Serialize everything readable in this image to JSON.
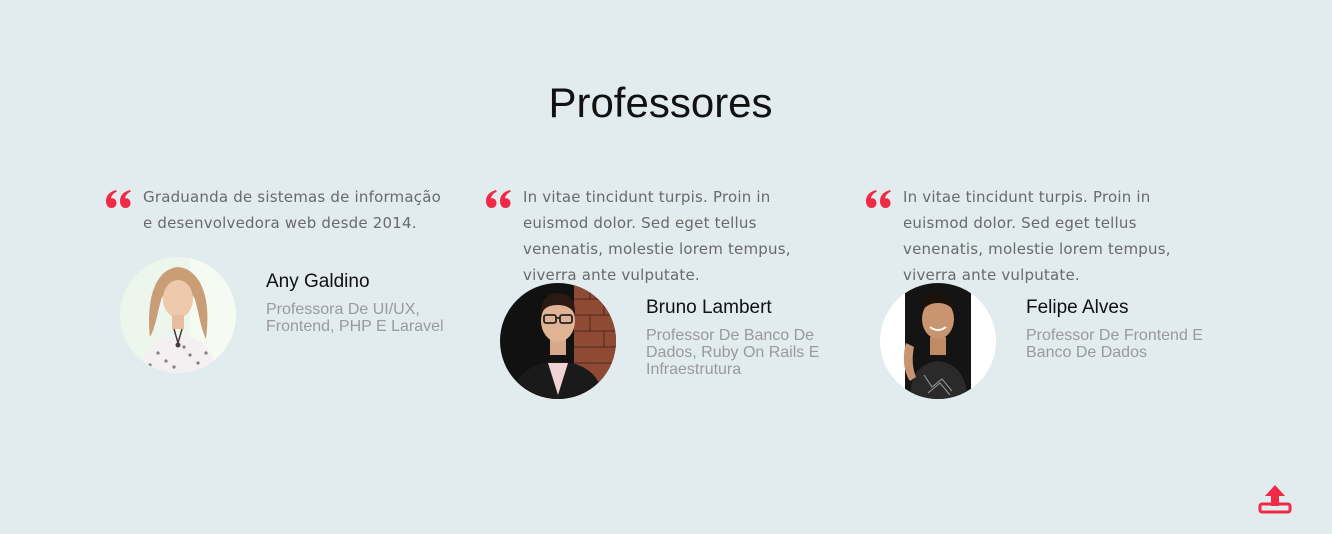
{
  "section": {
    "title": "Professores"
  },
  "colors": {
    "accent": "#ef2a47",
    "background": "#e2ebed"
  },
  "testimonials": [
    {
      "quote": "Graduanda de sistemas de informação e desenvolvedora web desde 2014.",
      "name": "Any Galdino",
      "role": "Professora De UI/UX, Frontend, PHP E Laravel",
      "icon": "quote-icon"
    },
    {
      "quote": "In vitae tincidunt turpis. Proin in euismod dolor. Sed eget tellus venenatis, molestie lorem tempus, viverra ante vulputate.",
      "name": "Bruno Lambert",
      "role": "Professor De Banco De Dados, Ruby On Rails E Infraestrutura",
      "icon": "quote-icon"
    },
    {
      "quote": "In vitae tincidunt turpis. Proin in euismod dolor. Sed eget tellus venenatis, molestie lorem tempus, viverra ante vulputate.",
      "name": "Felipe Alves",
      "role": "Professor De Frontend E Banco De Dados",
      "icon": "quote-icon"
    }
  ],
  "scroll_top": {
    "icon": "upload-arrow-icon"
  }
}
